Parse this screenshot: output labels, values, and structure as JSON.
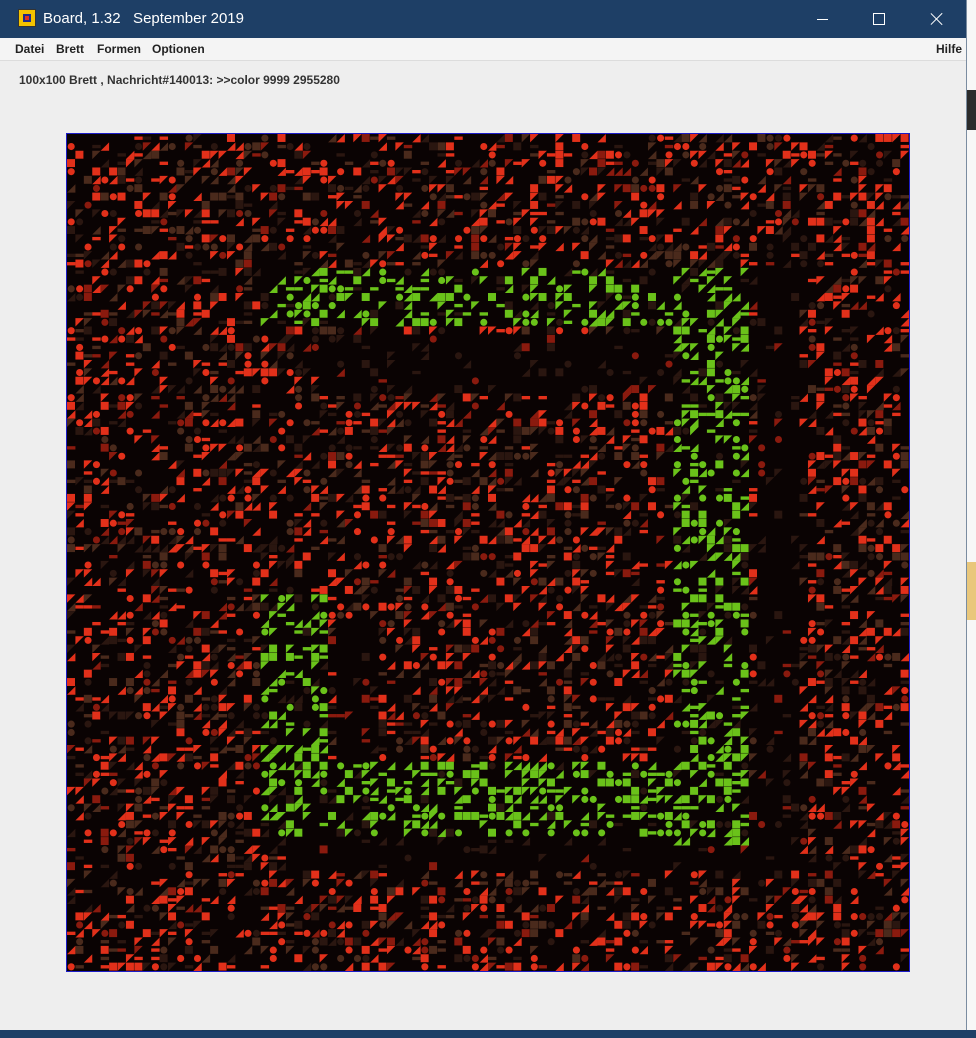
{
  "window": {
    "title": "Board, 1.32   September 2019"
  },
  "menu": {
    "items": [
      "Datei",
      "Brett",
      "Formen",
      "Optionen"
    ],
    "help": "Hilfe"
  },
  "status": {
    "text": "100x100 Brett , Nachricht#140013: >>color 9999 2955280"
  },
  "board": {
    "rows": 100,
    "cols": 100,
    "background": "#0a0303",
    "border_color": "#1c1cc8",
    "palette": {
      "red": "#e2301a",
      "dark_red": "#8a1a0e",
      "brown": "#4a2a1c",
      "dark_brown": "#2a1610",
      "green": "#6ac21a"
    },
    "green_outline_cells": {
      "top_row": [
        16,
        79
      ],
      "bottom_row": [
        75,
        83
      ],
      "left_col": [
        55,
        83
      ],
      "right_col": [
        16,
        84
      ]
    }
  },
  "colors": {
    "titlebar": "#1e3f66",
    "window_bg": "#eeeeee"
  }
}
